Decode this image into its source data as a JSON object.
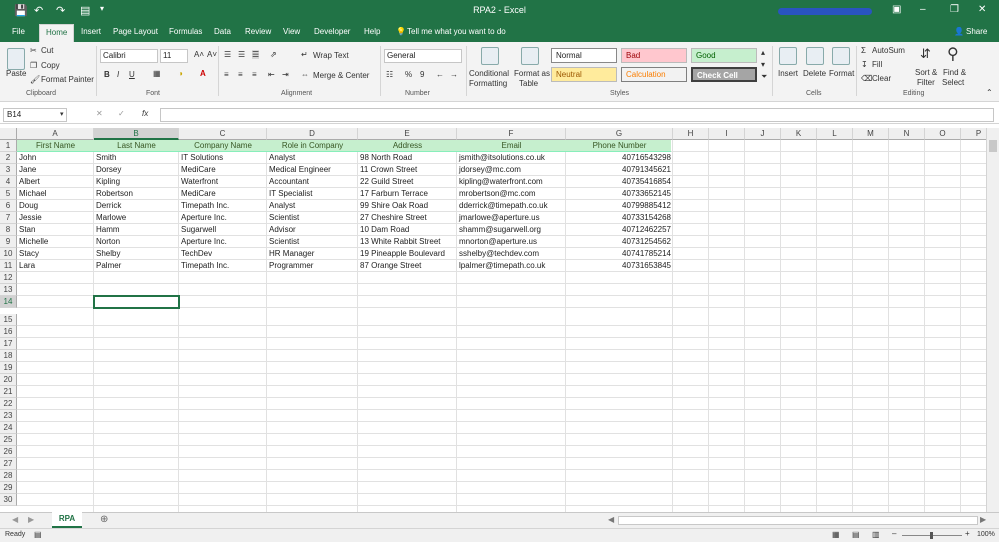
{
  "window": {
    "title": "RPA2  -  Excel",
    "share": "Share"
  },
  "ribbon_tabs": [
    "File",
    "Home",
    "Insert",
    "Page Layout",
    "Formulas",
    "Data",
    "Review",
    "View",
    "Developer",
    "Help"
  ],
  "tell_me": "Tell me what you want to do",
  "clipboard": {
    "paste": "Paste",
    "cut": "Cut",
    "copy": "Copy",
    "format_painter": "Format Painter",
    "label": "Clipboard"
  },
  "font": {
    "name": "Calibri",
    "size": "11",
    "bold": "B",
    "italic": "I",
    "underline": "U",
    "label": "Font"
  },
  "alignment": {
    "wrap": "Wrap Text",
    "merge": "Merge & Center",
    "label": "Alignment"
  },
  "number": {
    "format": "General",
    "percent": "%",
    "comma": "9",
    "label": "Number"
  },
  "styles": {
    "conditional": "Conditional",
    "conditional2": "Formatting",
    "format_as": "Format as",
    "format_as2": "Table",
    "normal": "Normal",
    "bad": "Bad",
    "good": "Good",
    "neutral": "Neutral",
    "calculation": "Calculation",
    "check_cell": "Check Cell",
    "label": "Styles"
  },
  "cells_group": {
    "insert": "Insert",
    "delete": "Delete",
    "format": "Format",
    "label": "Cells"
  },
  "editing": {
    "autosum": "AutoSum",
    "fill": "Fill",
    "clear": "Clear",
    "sort": "Sort &",
    "sort2": "Filter",
    "find": "Find &",
    "find2": "Select",
    "label": "Editing"
  },
  "name_box": "B14",
  "fx": "fx",
  "columns": [
    "A",
    "B",
    "C",
    "D",
    "E",
    "F",
    "G",
    "H",
    "I",
    "J",
    "K",
    "L",
    "M",
    "N",
    "O",
    "P"
  ],
  "selected_column": "B",
  "rows": [
    "1",
    "2",
    "3",
    "4",
    "5",
    "6",
    "7",
    "8",
    "9",
    "10",
    "11",
    "12",
    "13",
    "14",
    "15",
    "16",
    "17",
    "18",
    "19",
    "20",
    "21",
    "22",
    "23",
    "24",
    "25",
    "26",
    "27",
    "28",
    "29",
    "30"
  ],
  "selected_row": "14",
  "table": {
    "headers": [
      "First Name",
      "Last Name",
      "Company Name",
      "Role in Company",
      "Address",
      "Email",
      "Phone Number"
    ],
    "rows": [
      [
        "John",
        "Smith",
        "IT Solutions",
        "Analyst",
        "98 North Road",
        "jsmith@itsolutions.co.uk",
        "40716543298"
      ],
      [
        "Jane",
        "Dorsey",
        "MediCare",
        "Medical Engineer",
        "11 Crown Street",
        "jdorsey@mc.com",
        "40791345621"
      ],
      [
        "Albert",
        "Kipling",
        "Waterfront",
        "Accountant",
        "22 Guild Street",
        "kipling@waterfront.com",
        "40735416854"
      ],
      [
        "Michael",
        "Robertson",
        "MediCare",
        "IT Specialist",
        "17 Farburn Terrace",
        "mrobertson@mc.com",
        "40733652145"
      ],
      [
        "Doug",
        "Derrick",
        "Timepath Inc.",
        "Analyst",
        "99 Shire Oak Road",
        "dderrick@timepath.co.uk",
        "40799885412"
      ],
      [
        "Jessie",
        "Marlowe",
        "Aperture Inc.",
        "Scientist",
        "27 Cheshire Street",
        "jmarlowe@aperture.us",
        "40733154268"
      ],
      [
        "Stan",
        "Hamm",
        "Sugarwell",
        "Advisor",
        "10 Dam Road",
        "shamm@sugarwell.org",
        "40712462257"
      ],
      [
        "Michelle",
        "Norton",
        "Aperture Inc.",
        "Scientist",
        "13 White Rabbit Street",
        "mnorton@aperture.us",
        "40731254562"
      ],
      [
        "Stacy",
        "Shelby",
        "TechDev",
        "HR Manager",
        "19 Pineapple Boulevard",
        "sshelby@techdev.com",
        "40741785214"
      ],
      [
        "Lara",
        "Palmer",
        "Timepath Inc.",
        "Programmer",
        "87 Orange Street",
        "lpalmer@timepath.co.uk",
        "40731653845"
      ]
    ]
  },
  "sheet_tab": "RPA",
  "status": {
    "ready": "Ready",
    "zoom": "100%"
  },
  "colors": {
    "accent": "#217346",
    "header_fill": "#c6efce",
    "header_text": "#375623"
  }
}
